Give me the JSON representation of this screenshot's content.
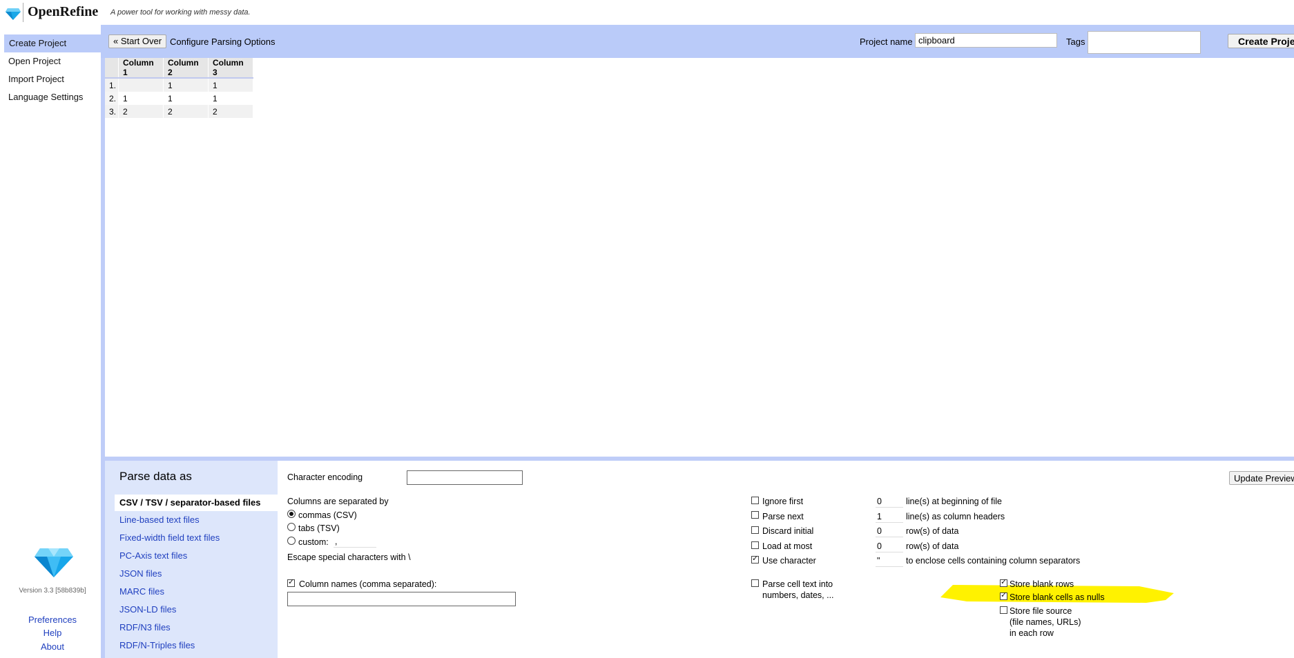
{
  "header": {
    "app_name": "OpenRefine",
    "tagline": "A power tool for working with messy data."
  },
  "nav": {
    "items": [
      {
        "label": "Create Project",
        "active": true
      },
      {
        "label": "Open Project",
        "active": false
      },
      {
        "label": "Import Project",
        "active": false
      },
      {
        "label": "Language Settings",
        "active": false
      }
    ],
    "version": "Version 3.3 [58b839b]",
    "links": [
      "Preferences",
      "Help",
      "About"
    ]
  },
  "toolbar": {
    "start_over": "« Start Over",
    "configure": "Configure Parsing Options",
    "project_name_label": "Project name",
    "project_name_value": "clipboard",
    "tags_label": "Tags",
    "create_project": "Create Project"
  },
  "preview_table": {
    "headers": [
      "Column 1",
      "Column 2",
      "Column 3"
    ],
    "rows": [
      {
        "num": "1.",
        "cells": [
          "",
          "1",
          "1"
        ]
      },
      {
        "num": "2.",
        "cells": [
          "1",
          "1",
          "1"
        ]
      },
      {
        "num": "3.",
        "cells": [
          "2",
          "2",
          "2"
        ]
      }
    ]
  },
  "parse": {
    "title": "Parse data as",
    "formats": [
      {
        "label": "CSV / TSV / separator-based files",
        "selected": true
      },
      {
        "label": "Line-based text files",
        "selected": false
      },
      {
        "label": "Fixed-width field text files",
        "selected": false
      },
      {
        "label": "PC-Axis text files",
        "selected": false
      },
      {
        "label": "JSON files",
        "selected": false
      },
      {
        "label": "MARC files",
        "selected": false
      },
      {
        "label": "JSON-LD files",
        "selected": false
      },
      {
        "label": "RDF/N3 files",
        "selected": false
      },
      {
        "label": "RDF/N-Triples files",
        "selected": false
      }
    ],
    "character_encoding_label": "Character encoding",
    "character_encoding_value": "",
    "update_preview": "Update Preview",
    "columns_separated_label": "Columns are separated by",
    "separator_options": {
      "commas": "commas (CSV)",
      "tabs": "tabs (TSV)",
      "custom": "custom:",
      "custom_value": ","
    },
    "escape_label": "Escape special characters with \\",
    "column_names_label": "Column names (comma separated):",
    "ignore_first_label": "Ignore first",
    "ignore_first_value": "0",
    "ignore_first_suffix": "line(s) at beginning of file",
    "parse_next_label": "Parse next",
    "parse_next_value": "1",
    "parse_next_suffix": "line(s) as column headers",
    "discard_initial_label": "Discard initial",
    "discard_initial_value": "0",
    "discard_initial_suffix": "row(s) of data",
    "load_at_most_label": "Load at most",
    "load_at_most_value": "0",
    "load_at_most_suffix": "row(s) of data",
    "use_character_label": "Use character",
    "use_character_value": "\"",
    "use_character_suffix": "to enclose cells containing column separators",
    "parse_cell_text_line1": "Parse cell text into",
    "parse_cell_text_line2": "numbers, dates, ...",
    "store_blank_rows": "Store blank rows",
    "store_blank_cells": "Store blank cells as nulls",
    "store_file_source_line1": "Store file source",
    "store_file_source_line2": "(file names, URLs)",
    "store_file_source_line3": "in each row"
  },
  "colors": {
    "toolbar_bg": "#bacbf9",
    "format_panel_bg": "#dde6fb",
    "link": "#1f3fbf",
    "highlight": "#fff200"
  }
}
